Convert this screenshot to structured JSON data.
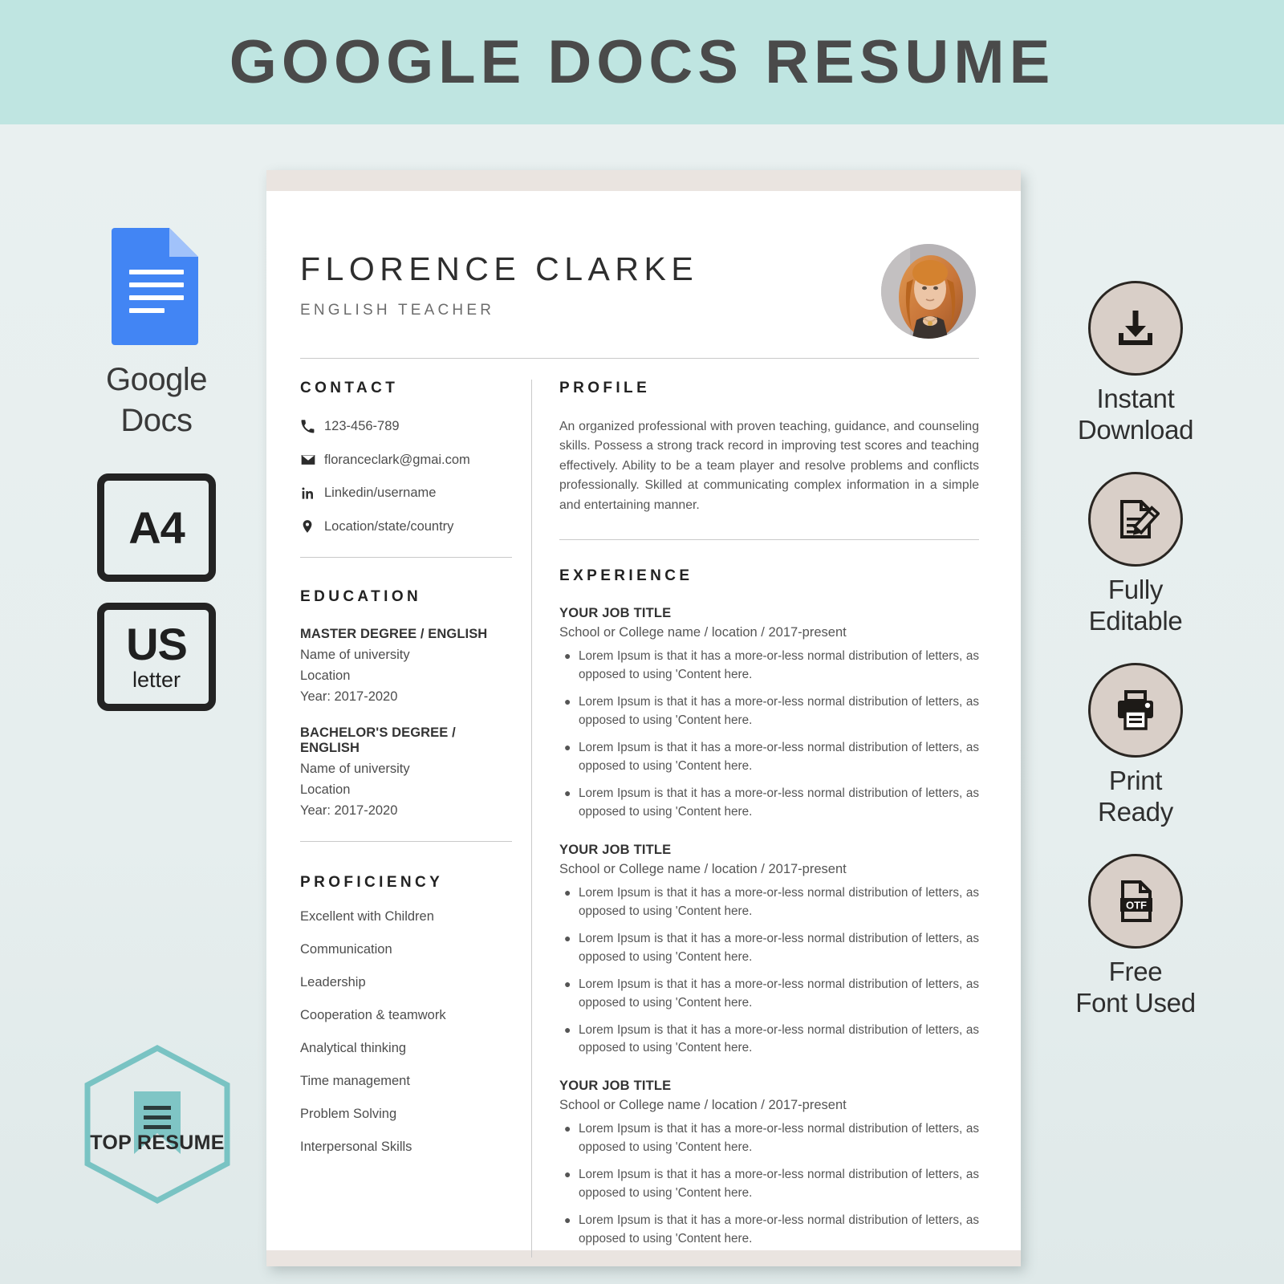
{
  "banner": {
    "title": "GOOGLE DOCS RESUME",
    "bg_color": "#bfe5e1"
  },
  "left_panel": {
    "gdocs_icon": "google-docs-icon",
    "gdocs_label_line1": "Google",
    "gdocs_label_line2": "Docs",
    "size_boxes": [
      {
        "main": "A4",
        "sub": ""
      },
      {
        "main": "US",
        "sub": "letter"
      }
    ],
    "badge": {
      "icon": "bookmark-icon",
      "label": "TOP RESUME",
      "color": "#79c3c3"
    }
  },
  "right_panel": {
    "features": [
      {
        "icon": "download-icon",
        "line1": "Instant",
        "line2": "Download"
      },
      {
        "icon": "edit-document-icon",
        "line1": "Fully",
        "line2": "Editable"
      },
      {
        "icon": "printer-icon",
        "line1": "Print",
        "line2": "Ready"
      },
      {
        "icon": "otf-file-icon",
        "line1": "Free",
        "line2": "Font Used"
      }
    ],
    "circle_color": "#d9cfc8"
  },
  "resume": {
    "name": "FLORENCE CLARKE",
    "role": "ENGLISH TEACHER",
    "avatar": "profile-photo",
    "contact": {
      "heading": "CONTACT",
      "items": [
        {
          "icon": "phone-icon",
          "text": "123-456-789"
        },
        {
          "icon": "envelope-icon",
          "text": "floranceclark@gmai.com"
        },
        {
          "icon": "linkedin-icon",
          "text": "Linkedin/username"
        },
        {
          "icon": "location-pin-icon",
          "text": "Location/state/country"
        }
      ]
    },
    "education": {
      "heading": "EDUCATION",
      "entries": [
        {
          "degree": "MASTER DEGREE / ENGLISH",
          "university": "Name of university",
          "location": "Location",
          "year": "Year: 2017-2020"
        },
        {
          "degree": "BACHELOR'S DEGREE / ENGLISH",
          "university": "Name of university",
          "location": "Location",
          "year": "Year: 2017-2020"
        }
      ]
    },
    "proficiency": {
      "heading": "PROFICIENCY",
      "items": [
        "Excellent with Children",
        "Communication",
        "Leadership",
        "Cooperation & teamwork",
        "Analytical thinking",
        "Time management",
        "Problem Solving",
        "Interpersonal Skills"
      ]
    },
    "profile": {
      "heading": "PROFILE",
      "text": "An organized professional with proven teaching, guidance, and counseling skills. Possess a strong track record in improving test scores and teaching effectively. Ability to be a team player and resolve problems and conflicts professionally. Skilled at communicating complex information in a simple and entertaining manner."
    },
    "experience": {
      "heading": "EXPERIENCE",
      "jobs": [
        {
          "title": "YOUR JOB TITLE",
          "meta": "School or College name / location / 2017-present",
          "bullets": [
            "Lorem Ipsum is that it has a more-or-less normal distribution of letters, as opposed to using 'Content here.",
            "Lorem Ipsum is that it has a more-or-less normal distribution of letters, as opposed to using 'Content here.",
            "Lorem Ipsum is that it has a more-or-less normal distribution of letters, as opposed to using 'Content here.",
            "Lorem Ipsum is that it has a more-or-less normal distribution of letters, as opposed to using 'Content here."
          ]
        },
        {
          "title": "YOUR JOB TITLE",
          "meta": "School or College name / location / 2017-present",
          "bullets": [
            "Lorem Ipsum is that it has a more-or-less normal distribution of letters, as opposed to using 'Content here.",
            "Lorem Ipsum is that it has a more-or-less normal distribution of letters, as opposed to using 'Content here.",
            "Lorem Ipsum is that it has a more-or-less normal distribution of letters, as opposed to using 'Content here.",
            "Lorem Ipsum is that it has a more-or-less normal distribution of letters, as opposed to using 'Content here."
          ]
        },
        {
          "title": "YOUR JOB TITLE",
          "meta": "School or College name / location / 2017-present",
          "bullets": [
            "Lorem Ipsum is that it has a more-or-less normal distribution of letters, as opposed to using 'Content here.",
            "Lorem Ipsum is that it has a more-or-less normal distribution of letters, as opposed to using 'Content here.",
            "Lorem Ipsum is that it has a more-or-less normal distribution of letters, as opposed to using 'Content here."
          ]
        }
      ]
    }
  }
}
